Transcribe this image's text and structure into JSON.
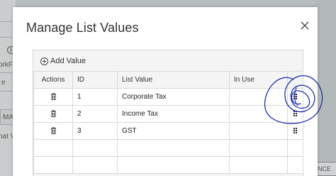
{
  "background": {
    "left_fragments": [
      "orkFlo",
      "e",
      "MA",
      "nat V"
    ],
    "bottom_right_button": "ANCE"
  },
  "modal": {
    "title": "Manage List Values",
    "add_value_label": "Add Value",
    "columns": [
      "Actions",
      "ID",
      "List Value",
      "In Use"
    ],
    "rows": [
      {
        "id": "1",
        "value": "Corporate Tax",
        "in_use": ""
      },
      {
        "id": "2",
        "value": "Income Tax",
        "in_use": ""
      },
      {
        "id": "3",
        "value": "GST",
        "in_use": ""
      }
    ]
  },
  "colors": {
    "backdrop": "#b7bcbc",
    "annotation_ink": "#1e2fb0"
  }
}
